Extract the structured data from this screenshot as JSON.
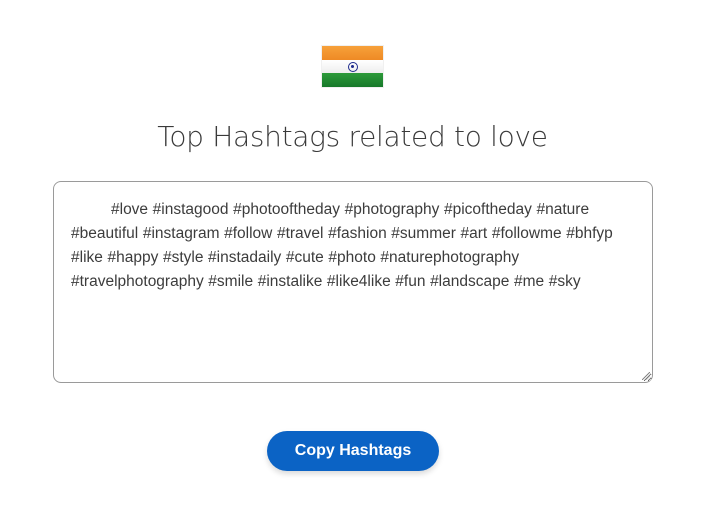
{
  "flag": {
    "icon": "india-flag-icon",
    "colors": {
      "saffron": "#f39a33",
      "white": "#ffffff",
      "green": "#1f8a31",
      "chakra": "#1d2a8c"
    }
  },
  "header": {
    "title": "Top Hashtags related to love"
  },
  "hashtags": {
    "text": "#love #instagood #photooftheday #photography #picoftheday #nature #beautiful #instagram #follow #travel #fashion #summer #art #followme #bhfyp #like #happy #style #instadaily #cute #photo #naturephotography #travelphotography #smile #instalike #like4like #fun #landscape #me #sky"
  },
  "actions": {
    "copy_label": "Copy Hashtags"
  },
  "colors": {
    "accent": "#0b63c5",
    "text": "#3a3a3a",
    "border": "#9a9a9a"
  }
}
